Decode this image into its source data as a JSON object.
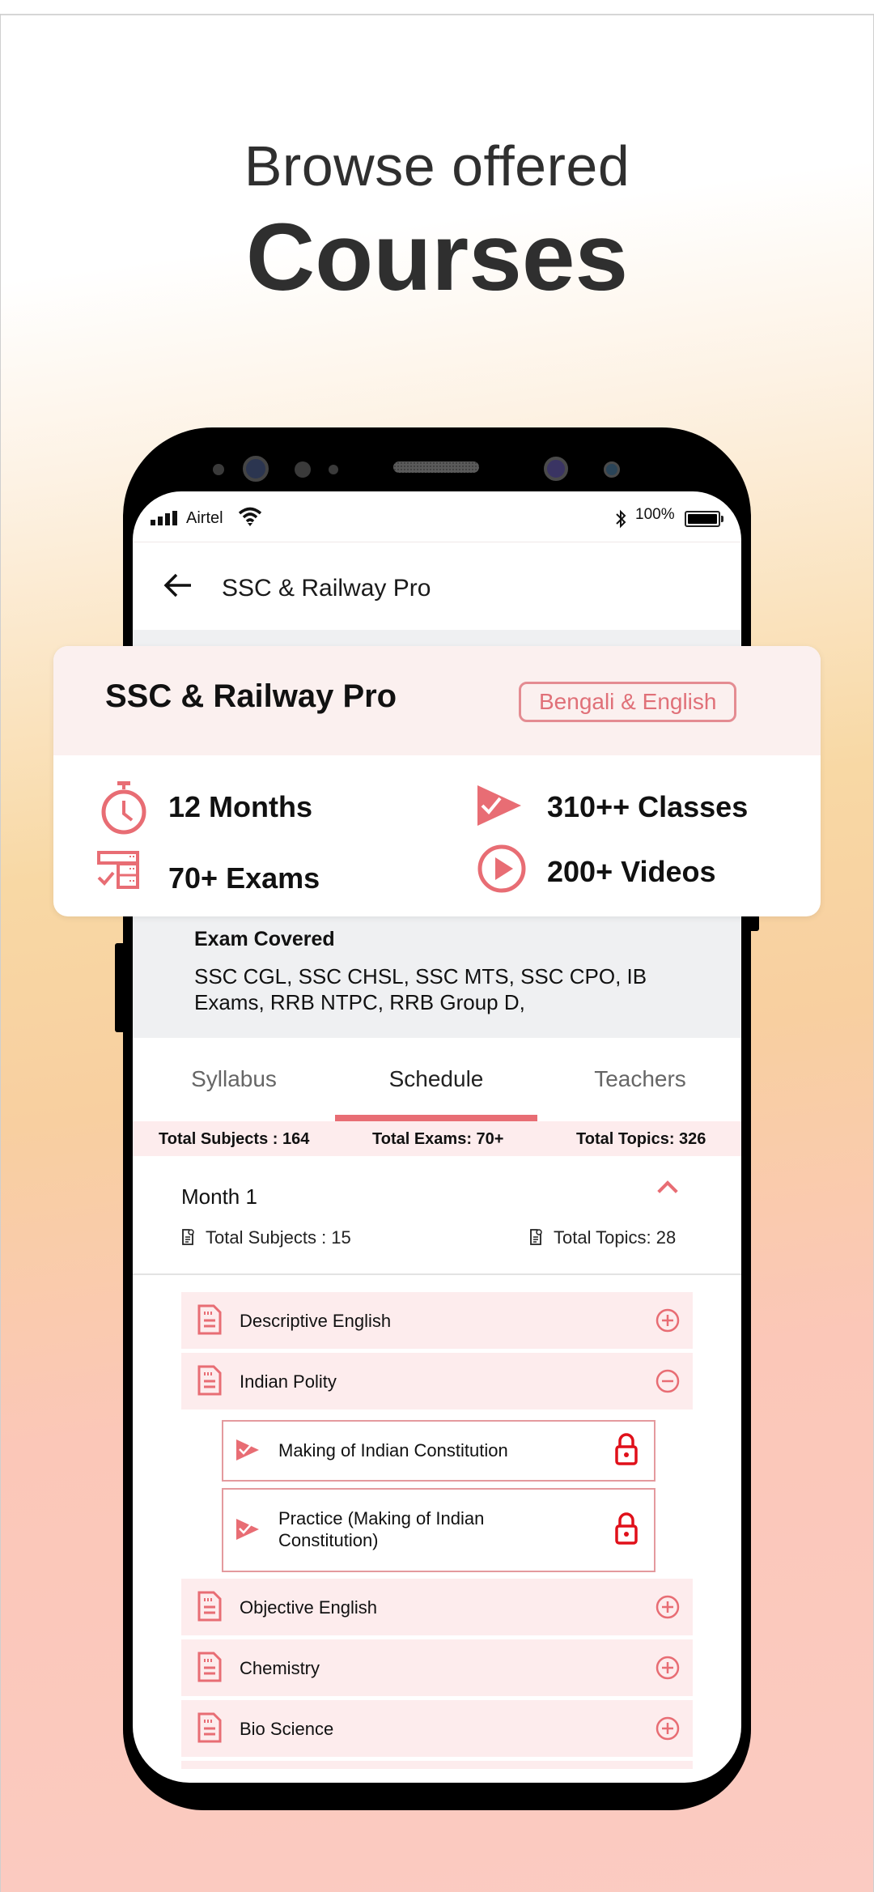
{
  "promo": {
    "line1": "Browse offered",
    "line2": "Courses"
  },
  "status_bar": {
    "carrier": "Airtel",
    "bluetooth_icon": "bluetooth-icon",
    "battery_percent": "100%"
  },
  "app_bar": {
    "back_icon": "arrow-left-icon",
    "title": "SSC & Railway Pro"
  },
  "course_card": {
    "title": "SSC & Railway Pro",
    "language_badge": "Bengali & English",
    "stats": [
      {
        "icon": "stopwatch-icon",
        "label": "12 Months"
      },
      {
        "icon": "class-play-check-icon",
        "label": "310++ Classes"
      },
      {
        "icon": "exam-checklist-icon",
        "label": "70+ Exams"
      },
      {
        "icon": "play-circle-icon",
        "label": "200+ Videos"
      }
    ]
  },
  "exam_covered": {
    "title": "Exam Covered",
    "text": "SSC CGL, SSC CHSL, SSC MTS, SSC CPO, IB Exams, RRB NTPC, RRB Group D,"
  },
  "tabs": [
    {
      "label": "Syllabus",
      "active": false
    },
    {
      "label": "Schedule",
      "active": true
    },
    {
      "label": "Teachers",
      "active": false
    }
  ],
  "totals": {
    "subjects": "Total Subjects : 164",
    "exams": "Total Exams: 70+",
    "topics": "Total Topics: 326"
  },
  "month": {
    "title": "Month 1",
    "subjects": "Total Subjects : 15",
    "topics": "Total Topics: 28",
    "expanded": true
  },
  "subjects": [
    {
      "label": "Descriptive English",
      "expanded": false
    },
    {
      "label": "Indian Polity",
      "expanded": true,
      "topics": [
        {
          "label": "Making of Indian Constitution",
          "locked": true
        },
        {
          "label": "Practice (Making of Indian Constitution)",
          "locked": true
        }
      ]
    },
    {
      "label": "Objective English",
      "expanded": false
    },
    {
      "label": "Chemistry",
      "expanded": false
    },
    {
      "label": "Bio Science",
      "expanded": false
    }
  ],
  "colors": {
    "accent": "#e86d74",
    "accent_light_bg": "#fdeced",
    "lock_red": "#e0101a",
    "card_head_bg": "#fbf0ef"
  }
}
